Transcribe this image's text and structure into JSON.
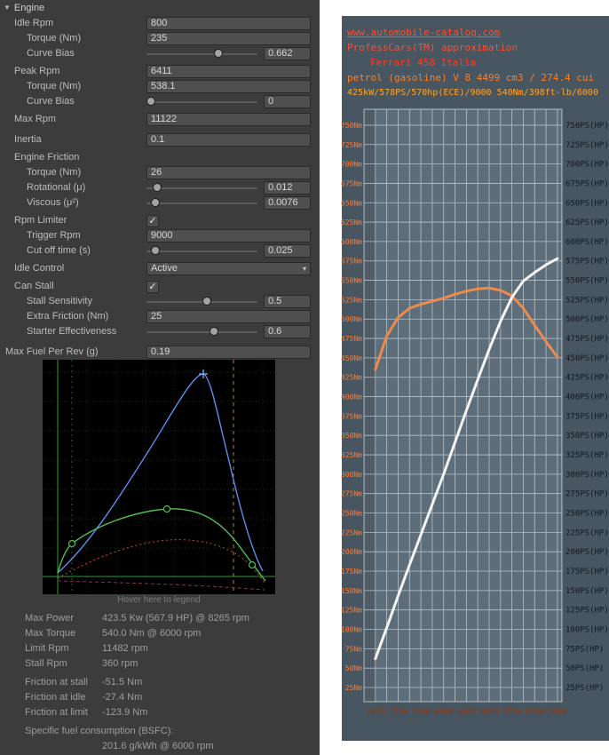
{
  "inspector": {
    "title": "Engine",
    "graph_hint": "Hover here to legend",
    "colors": {
      "panel_bg": "#3c3c3c",
      "power_curve": "#5c8cf0",
      "torque_curve": "#4fc04f",
      "friction_curve": "#cc4455",
      "limit_marker": "#b8862a"
    },
    "rows": [
      {
        "name": "idle-rpm",
        "label": "Idle Rpm",
        "type": "field",
        "value": "800",
        "indent": 1
      },
      {
        "name": "idle-torque",
        "label": "Torque (Nm)",
        "type": "field",
        "value": "235",
        "indent": 2
      },
      {
        "name": "idle-curve-bias",
        "label": "Curve Bias",
        "type": "slider",
        "value": "0.662",
        "fraction": 0.66,
        "indent": 2
      },
      {
        "type": "gap"
      },
      {
        "name": "peak-rpm",
        "label": "Peak Rpm",
        "type": "field",
        "value": "6411",
        "indent": 1
      },
      {
        "name": "peak-torque",
        "label": "Torque (Nm)",
        "type": "field",
        "value": "538.1",
        "indent": 2
      },
      {
        "name": "peak-curve-bias",
        "label": "Curve Bias",
        "type": "slider",
        "value": "0",
        "fraction": 0,
        "indent": 2
      },
      {
        "type": "gap"
      },
      {
        "name": "max-rpm",
        "label": "Max Rpm",
        "type": "field",
        "value": "11122",
        "indent": 1
      },
      {
        "type": "gap2"
      },
      {
        "name": "inertia",
        "label": "Inertia",
        "type": "field",
        "value": "0.1",
        "indent": 1
      },
      {
        "type": "gap"
      },
      {
        "name": "engine-friction",
        "label": "Engine Friction",
        "type": "label",
        "indent": 1
      },
      {
        "name": "friction-torque",
        "label": "Torque (Nm)",
        "type": "field",
        "value": "26",
        "indent": 2
      },
      {
        "name": "rotational",
        "label": "Rotational (μ)",
        "type": "slider",
        "value": "0.012",
        "fraction": 0.06,
        "indent": 2
      },
      {
        "name": "viscous",
        "label": "Viscous (μ²)",
        "type": "slider",
        "value": "0.0076",
        "fraction": 0.04,
        "indent": 2
      },
      {
        "type": "gap"
      },
      {
        "name": "rpm-limiter",
        "label": "Rpm Limiter",
        "type": "checkbox",
        "checked": true,
        "indent": 1
      },
      {
        "name": "trigger-rpm",
        "label": "Trigger Rpm",
        "type": "field",
        "value": "9000",
        "indent": 2
      },
      {
        "name": "cut-off-time",
        "label": "Cut off time (s)",
        "type": "slider",
        "value": "0.025",
        "fraction": 0.04,
        "indent": 2
      },
      {
        "type": "gap"
      },
      {
        "name": "idle-control",
        "label": "Idle Control",
        "type": "dropdown",
        "value": "Active",
        "indent": 1
      },
      {
        "type": "gap"
      },
      {
        "name": "can-stall",
        "label": "Can Stall",
        "type": "checkbox",
        "checked": true,
        "indent": 1
      },
      {
        "name": "stall-sensitivity",
        "label": "Stall Sensitivity",
        "type": "slider",
        "value": "0.5",
        "fraction": 0.55,
        "indent": 2
      },
      {
        "name": "extra-friction",
        "label": "Extra Friction (Nm)",
        "type": "field",
        "value": "25",
        "indent": 2
      },
      {
        "name": "starter-effectiveness",
        "label": "Starter Effectiveness",
        "type": "slider",
        "value": "0.6",
        "fraction": 0.62,
        "indent": 2
      },
      {
        "type": "gap2"
      },
      {
        "name": "max-fuel-per-rev",
        "label": "Max Fuel Per Rev (g)",
        "type": "field",
        "value": "0.19",
        "indent": 0
      }
    ],
    "stats": [
      {
        "label": "Max Power",
        "value": "423.5 Kw (567.9 HP) @ 8265 rpm"
      },
      {
        "label": "Max Torque",
        "value": "540.0 Nm @ 6000 rpm"
      },
      {
        "label": "Limit Rpm",
        "value": "11482 rpm"
      },
      {
        "label": "Stall Rpm",
        "value": "360 rpm"
      },
      {
        "gap": true
      },
      {
        "label": "Friction at stall",
        "value": "-51.5 Nm"
      },
      {
        "label": "Friction at idle",
        "value": "-27.4 Nm"
      },
      {
        "label": "Friction at limit",
        "value": "-123.9 Nm"
      },
      {
        "gap": true
      },
      {
        "label": "Specific fuel consumption (BSFC):",
        "value": ""
      },
      {
        "label": "",
        "value": "201.6 g/kWh @ 6000 rpm"
      }
    ]
  },
  "chart_style": {
    "panel_bg": "#485661",
    "plot_bg": "#5d6e7a",
    "band_bg": "#4a5660",
    "grid": "#cdd6dc",
    "left_tick": "#ff7a33",
    "right_tick": "#14191f",
    "x_tick": "#8a3a16",
    "title_colors": [
      "#ff4d2e",
      "#ff4d2e",
      "#ff3b24",
      "#ff7d22",
      "#ffa226"
    ]
  },
  "chart_data": {
    "type": "line",
    "title_lines": [
      "www.automobile-catalog.com",
      "ProfessCars(TM) approximation",
      "Ferrari 458 Italia",
      "petrol (gasoline) V 8 4499 cm3 / 274.4 cui",
      "425kW/578PS/570hp(ECE)/9000 540Nm/398ft-lb/6000"
    ],
    "x_rpm": [
      1000,
      1500,
      2000,
      2500,
      3000,
      3500,
      4000,
      4500,
      5000,
      5500,
      6000,
      6500,
      7000,
      7500,
      8000,
      8500,
      9000
    ],
    "series": [
      {
        "name": "Torque (Nm)",
        "color": "#ee8a4c",
        "values": [
          435,
          478,
          502,
          514,
          519,
          523,
          527,
          532,
          536,
          539,
          540,
          537,
          530,
          514,
          492,
          471,
          451
        ]
      },
      {
        "name": "Power (PS)",
        "color": "#f4f4f4",
        "values": [
          62,
          102,
          143,
          183,
          222,
          261,
          300,
          341,
          382,
          422,
          461,
          497,
          528,
          549,
          560,
          570,
          578
        ]
      }
    ],
    "x_axis": {
      "tick_labels": [
        1000,
        2000,
        3000,
        4000,
        5000,
        6000,
        7000,
        8000,
        9000
      ],
      "grid_step": 500,
      "range": [
        500,
        9200
      ]
    },
    "y_axis": {
      "tick_min": 25,
      "tick_max": 750,
      "tick_step": 25,
      "left_suffix": "Nm",
      "right_suffix": "PS(HP)"
    },
    "ylim": [
      0,
      770
    ],
    "grid": true,
    "legend_position": "none"
  }
}
